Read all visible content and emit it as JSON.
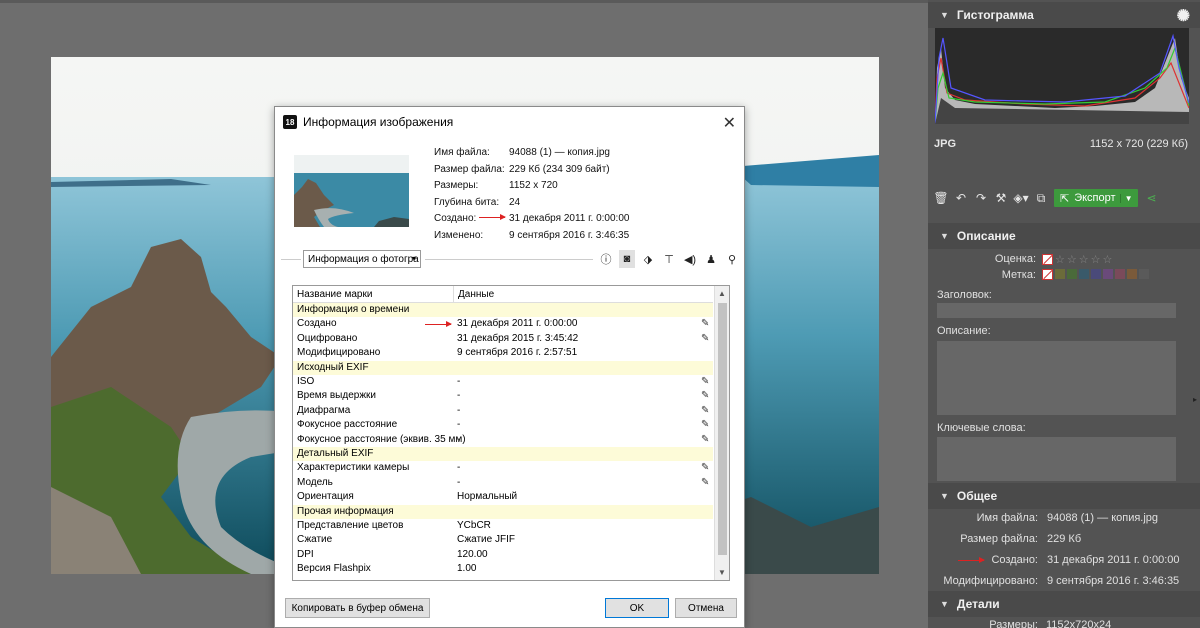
{
  "dialog": {
    "title": "Информация изображения",
    "logo_text": "18",
    "close_glyph": "✕",
    "info": [
      {
        "label": "Имя файла:",
        "value": "94088 (1) — копия.jpg"
      },
      {
        "label": "Размер файла:",
        "value": "229 Кб (234 309 байт)"
      },
      {
        "label": "Размеры:",
        "value": "1152 x 720"
      },
      {
        "label": "Глубина бита:",
        "value": "24"
      },
      {
        "label": "Создано:",
        "value": "31 декабря 2011 г. 0:00:00"
      },
      {
        "label": "Изменено:",
        "value": "9 сентября 2016 г. 3:46:35"
      }
    ],
    "dropdown_value": "Информация о фотогра",
    "tab_icons": [
      "info-icon",
      "camera-icon",
      "tag-icon",
      "signpost-icon",
      "speaker-icon",
      "person-icon",
      "location-pin-icon"
    ],
    "table": {
      "headers": [
        "Название марки",
        "Данные"
      ],
      "rows": [
        {
          "group": true,
          "name": "Информация о времени",
          "value": ""
        },
        {
          "name": "Создано",
          "value": "31 декабря 2011 г. 0:00:00",
          "edit": true
        },
        {
          "name": "Оцифровано",
          "value": "31 декабря 2015 г. 3:45:42",
          "edit": true
        },
        {
          "name": "Модифицировано",
          "value": "9 сентября 2016 г. 2:57:51",
          "edit": false
        },
        {
          "group": true,
          "name": "Исходный EXIF",
          "value": ""
        },
        {
          "name": "ISO",
          "value": "-",
          "edit": true
        },
        {
          "name": "Время выдержки",
          "value": "-",
          "edit": true
        },
        {
          "name": "Диафрагма",
          "value": "-",
          "edit": true
        },
        {
          "name": "Фокусное расстояние",
          "value": "-",
          "edit": true
        },
        {
          "name": "Фокусное расстояние (эквив. 35 мм)",
          "value": "-",
          "edit": true
        },
        {
          "group": true,
          "name": "Детальный EXIF",
          "value": ""
        },
        {
          "name": "Характеристики камеры",
          "value": "-",
          "edit": true
        },
        {
          "name": "Модель",
          "value": "-",
          "edit": true
        },
        {
          "name": "Ориентация",
          "value": "Нормальный",
          "edit": false
        },
        {
          "group": true,
          "name": "Прочая информация",
          "value": ""
        },
        {
          "name": "Представление цветов",
          "value": "YCbCR",
          "edit": false
        },
        {
          "name": "Сжатие",
          "value": "Сжатие JFIF",
          "edit": false
        },
        {
          "name": "DPI",
          "value": "120.00",
          "edit": false
        },
        {
          "name": "Версия Flashpix",
          "value": "1.00",
          "edit": false
        }
      ]
    },
    "copy_button": "Копировать в буфер обмена",
    "ok_button": "OK",
    "cancel_button": "Отмена"
  },
  "panel": {
    "histogram_title": "Гистограмма",
    "format": "JPG",
    "dims": "1152 x 720 (229 Кб)",
    "export_label": "Экспорт",
    "description_title": "Описание",
    "rating_label": "Оценка:",
    "mark_label": "Метка:",
    "header_label": "Заголовок:",
    "desc_label": "Описание:",
    "keywords_label": "Ключевые слова:",
    "general_title": "Общее",
    "general": [
      {
        "label": "Имя файла:",
        "value": "94088 (1) — копия.jpg"
      },
      {
        "label": "Размер файла:",
        "value": "229 Кб"
      },
      {
        "label": "Создано:",
        "value": "31 декабря 2011 г. 0:00:00"
      },
      {
        "label": "Модифицировано:",
        "value": "9 сентября 2016 г. 3:46:35"
      }
    ],
    "details_title": "Детали",
    "details_partial": "Размеры:",
    "details_partial_value": "1152x720x24",
    "swatch_colors": [
      "#6b6b3a",
      "#4a6a3a",
      "#3a5a6a",
      "#4a4a7a",
      "#6a4a7a",
      "#7a4a5a",
      "#7a5a3a",
      "#5a5a5a"
    ],
    "accent": "#3d9a3d"
  }
}
